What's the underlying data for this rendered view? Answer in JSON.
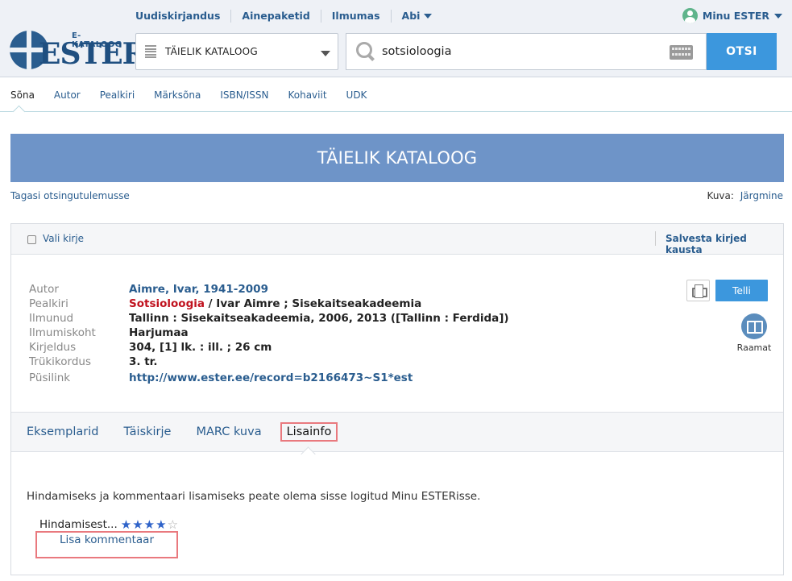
{
  "header": {
    "nav": [
      "Uudiskirjandus",
      "Ainepaketid",
      "Ilmumas",
      "Abi"
    ],
    "user_label": "Minu ESTER",
    "logo_small": "E-KATALOOG",
    "logo_big": "ESTER",
    "catalog_select": "TÄIELIK KATALOOG",
    "search_value": "sotsioloogia",
    "search_button": "OTSI"
  },
  "search_tabs": [
    "Sõna",
    "Autor",
    "Pealkiri",
    "Märksõna",
    "ISBN/ISSN",
    "Kohaviit",
    "UDK"
  ],
  "banner_title": "TÄIELIK KATALOOG",
  "back_link": "Tagasi otsingutulemusse",
  "kuva": {
    "label": "Kuva:",
    "link": "Järgmine"
  },
  "toolbar": {
    "select_record": "Vali kirje",
    "save_records": "Salvesta kirjed kausta"
  },
  "record": {
    "author_label": "Autor",
    "author": "Aimre, Ivar, 1941-2009",
    "title_label": "Pealkiri",
    "title_highlight": "Sotsioloogia",
    "title_rest": " / Ivar Aimre ; Sisekaitseakadeemia",
    "published_label": "Ilmunud",
    "published": "Tallinn : Sisekaitseakadeemia, 2006, 2013 ([Tallinn : Ferdida])",
    "place_label": "Ilmumiskoht",
    "place": "Harjumaa",
    "description_label": "Kirjeldus",
    "description": "304, [1] lk. : ill. ; 26 cm",
    "edition_label": "Trükikordus",
    "edition": "3. tr.",
    "permalink_label": "Püsilink",
    "permalink": "http://www.ester.ee/record=b2166473~S1*est"
  },
  "actions": {
    "order_button": "Telli",
    "type_label": "Raamat"
  },
  "detail_tabs": [
    "Eksemplarid",
    "Täiskirje",
    "MARC kuva",
    "Lisainfo"
  ],
  "info": {
    "login_message": "Hindamiseks ja kommentaari lisamiseks peate olema sisse logitud Minu ESTERisse.",
    "rating_label": "Hindamisest...",
    "rating_stars": 4,
    "rating_max": 5,
    "comment_button": "Lisa kommentaar"
  },
  "colors": {
    "accent": "#3c97dd",
    "banner": "#6e94c8",
    "link": "#2a5d8f",
    "highlight": "#c0121e",
    "focus_outline": "#e9797e"
  }
}
